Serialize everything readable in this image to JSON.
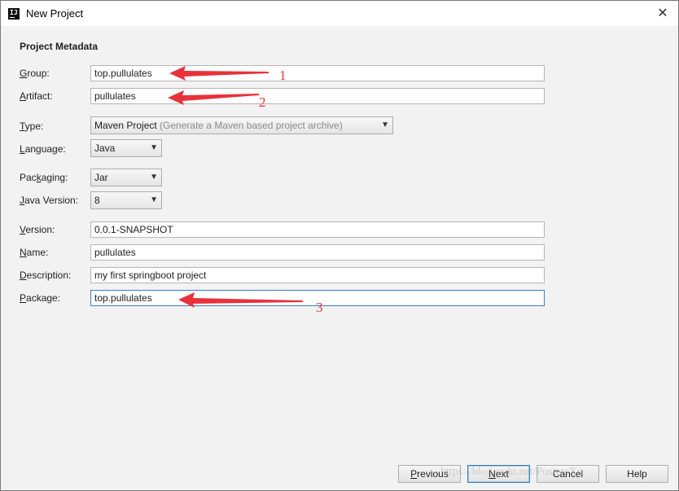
{
  "window": {
    "title": "New Project",
    "close_glyph": "✕"
  },
  "section_title": "Project Metadata",
  "fields": {
    "group": {
      "key": "G",
      "rest": "roup:",
      "value": "top.pullulates"
    },
    "artifact": {
      "key": "A",
      "rest": "rtifact:",
      "value": "pullulates"
    },
    "version": {
      "key": "V",
      "rest": "ersion:",
      "value": "0.0.1-SNAPSHOT"
    },
    "name": {
      "key": "N",
      "rest": "ame:",
      "value": "pullulates"
    },
    "description": {
      "key": "D",
      "rest": "escription:",
      "value": "my first springboot project"
    },
    "package": {
      "key": "P",
      "rest": "ackage:",
      "value": "top.pullulates"
    }
  },
  "selects": {
    "type": {
      "key": "T",
      "rest": "ype:",
      "value": "Maven Project",
      "hint": "(Generate a Maven based project archive)"
    },
    "language": {
      "key": "L",
      "rest": "anguage:",
      "value": "Java"
    },
    "packaging": {
      "pre": "Pac",
      "key": "k",
      "rest": "aging:",
      "value": "Jar"
    },
    "java_version": {
      "key": "J",
      "rest": "ava Version:",
      "value": "8"
    }
  },
  "buttons": {
    "previous": {
      "key": "P",
      "rest": "revious"
    },
    "next": {
      "key": "N",
      "rest": "ext"
    },
    "cancel": {
      "text": "Cancel"
    },
    "help": {
      "text": "Help"
    }
  },
  "annotations": [
    "1",
    "2",
    "3"
  ],
  "annotation_color": "#e8313a",
  "watermark": "https://blog.csdn.net/PostersXu"
}
